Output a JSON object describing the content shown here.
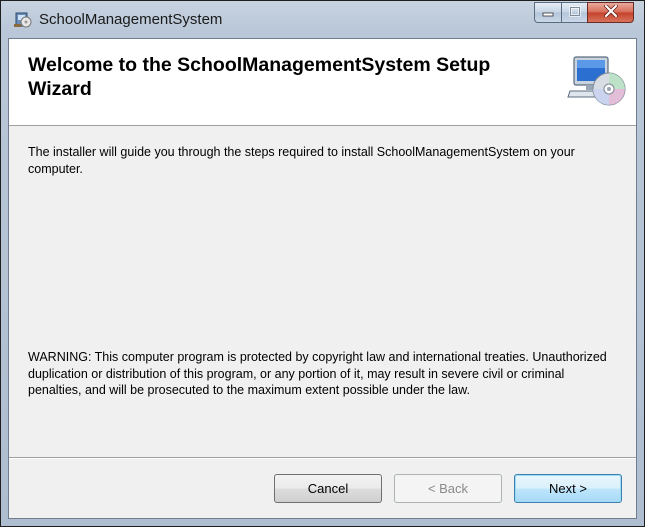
{
  "window": {
    "title": "SchoolManagementSystem",
    "caption_buttons": {
      "minimize_icon": "minimize-icon",
      "maximize_icon": "maximize-icon",
      "close_icon": "close-icon"
    }
  },
  "header": {
    "title": "Welcome to the SchoolManagementSystem Setup Wizard",
    "graphic_icon": "computer-cd-icon"
  },
  "body": {
    "intro": "The installer will guide you through the steps required to install SchoolManagementSystem on your computer.",
    "warning": "WARNING: This computer program is protected by copyright law and international treaties. Unauthorized duplication or distribution of this program, or any portion of it, may result in severe civil or criminal penalties, and will be prosecuted to the maximum extent possible under the law."
  },
  "footer": {
    "cancel_label": "Cancel",
    "back_label": "< Back",
    "next_label": "Next >",
    "back_enabled": false
  },
  "colors": {
    "title_gradient_top": "#c8d3e0",
    "close_button_red": "#c4412a",
    "next_button_border": "#3c7fb1"
  }
}
